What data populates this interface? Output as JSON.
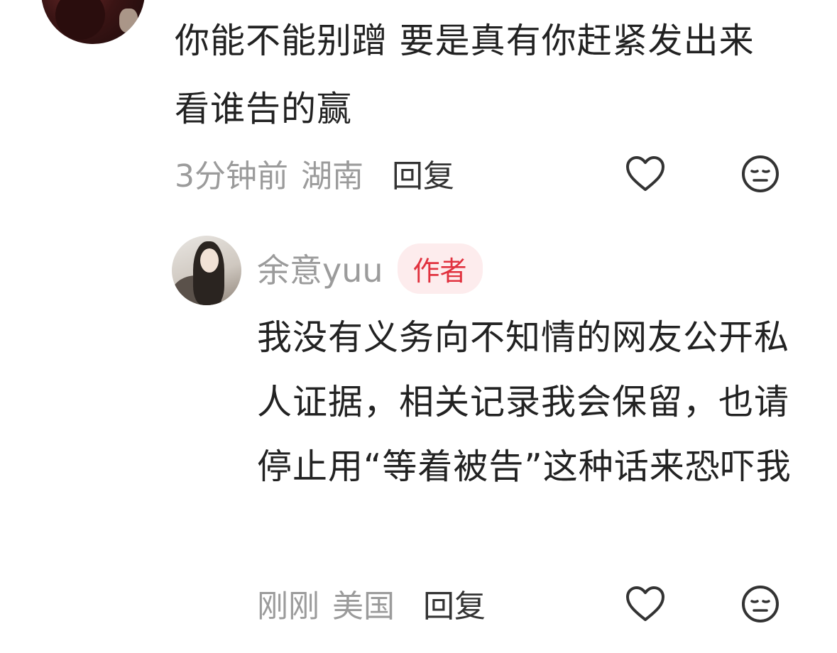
{
  "top_comment": {
    "text": "你能不能别蹭 要是真有你赶紧发出来 看谁告的赢",
    "time": "3分钟前",
    "location": "湖南",
    "reply_label": "回复"
  },
  "reply_comment": {
    "username": "余意yuu",
    "badge": "作者",
    "text": "我没有义务向不知情的网友公开私人证据，相关记录我会保留，也请停止用“等着被告”这种话来恐吓我",
    "time": "刚刚",
    "location": "美国",
    "reply_label": "回复"
  },
  "icons": {
    "like": "heart-outline-icon",
    "dislike": "neutral-face-icon"
  },
  "colors": {
    "text": "#222222",
    "meta": "#9b9b9b",
    "badge_text": "#e1323f",
    "badge_bg": "#fdeced"
  }
}
